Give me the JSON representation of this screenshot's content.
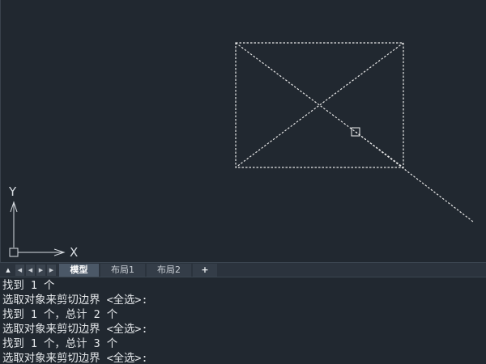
{
  "viewport": {
    "ucs": {
      "x_label": "X",
      "y_label": "Y"
    }
  },
  "tabs": {
    "nav": [
      "▲",
      "◀",
      "◀",
      "▶",
      "▶"
    ],
    "items": [
      {
        "label": "模型",
        "active": true
      },
      {
        "label": "布局1",
        "active": false
      },
      {
        "label": "布局2",
        "active": false
      }
    ],
    "add_label": "+"
  },
  "command_history": [
    "找到 1 个",
    "选取对象来剪切边界 <全选>:",
    "找到 1 个，总计 2 个",
    "选取对象来剪切边界 <全选>:",
    "找到 1 个，总计 3 个",
    "选取对象来剪切边界 <全选>:"
  ],
  "colors": {
    "background": "#212830",
    "tab_active": "#4b5867",
    "line": "#e8e8e8"
  }
}
